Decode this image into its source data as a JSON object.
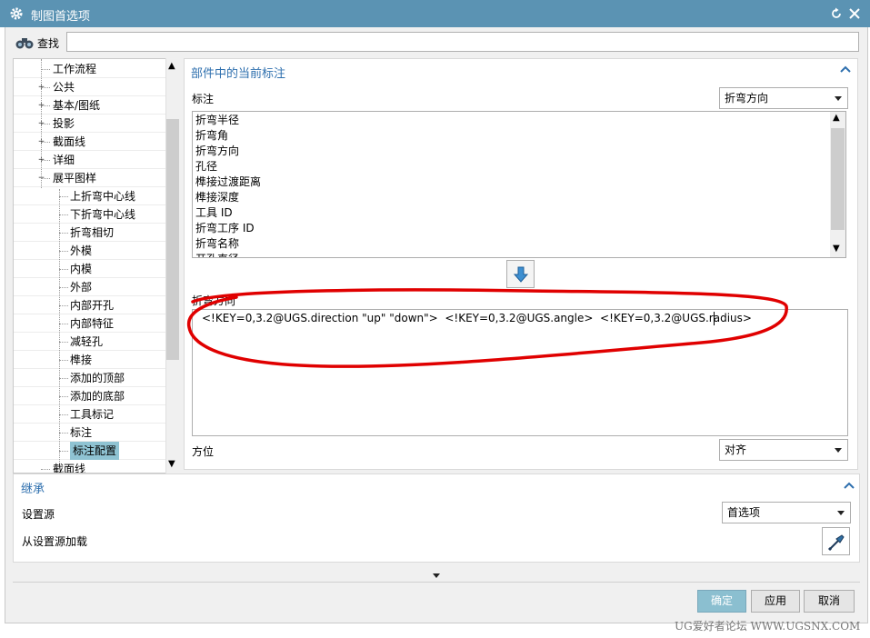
{
  "window": {
    "title": "制图首选项",
    "title_icon": "gear-icon",
    "reset_icon": "reset-icon",
    "close_icon": "close-icon"
  },
  "search": {
    "label": "查找",
    "value": "",
    "icon": "binoculars-icon"
  },
  "tree": {
    "items": [
      {
        "label": "工作流程",
        "level": 1,
        "expander": ""
      },
      {
        "label": "公共",
        "level": 1,
        "expander": "+"
      },
      {
        "label": "基本/图纸",
        "level": 1,
        "expander": "+"
      },
      {
        "label": "投影",
        "level": 1,
        "expander": "+"
      },
      {
        "label": "截面线",
        "level": 1,
        "expander": "+"
      },
      {
        "label": "详细",
        "level": 1,
        "expander": "+"
      },
      {
        "label": "展平图样",
        "level": 1,
        "expander": "−"
      },
      {
        "label": "上折弯中心线",
        "level": 2,
        "expander": ""
      },
      {
        "label": "下折弯中心线",
        "level": 2,
        "expander": ""
      },
      {
        "label": "折弯相切",
        "level": 2,
        "expander": ""
      },
      {
        "label": "外模",
        "level": 2,
        "expander": ""
      },
      {
        "label": "内模",
        "level": 2,
        "expander": ""
      },
      {
        "label": "外部",
        "level": 2,
        "expander": ""
      },
      {
        "label": "内部开孔",
        "level": 2,
        "expander": ""
      },
      {
        "label": "内部特征",
        "level": 2,
        "expander": ""
      },
      {
        "label": "减轻孔",
        "level": 2,
        "expander": ""
      },
      {
        "label": "榫接",
        "level": 2,
        "expander": ""
      },
      {
        "label": "添加的顶部",
        "level": 2,
        "expander": ""
      },
      {
        "label": "添加的底部",
        "level": 2,
        "expander": ""
      },
      {
        "label": "工具标记",
        "level": 2,
        "expander": ""
      },
      {
        "label": "标注",
        "level": 2,
        "expander": ""
      },
      {
        "label": "标注配置",
        "level": 2,
        "expander": "",
        "selected": true
      },
      {
        "label": "截面线",
        "level": 1,
        "expander": ""
      }
    ]
  },
  "section": {
    "title": "部件中的当前标注",
    "callout_label": "标注",
    "callout_value": "折弯方向",
    "list_items": [
      "折弯半径",
      "折弯角",
      "折弯方向",
      "孔径",
      "榫接过渡距离",
      "榫接深度",
      "工具 ID",
      "折弯工序 ID",
      "折弯名称",
      "开孔直径"
    ],
    "insert_icon": "arrow-down-icon",
    "text_label": "折弯方向",
    "text_value": "<!KEY=0,3.2@UGS.direction \"up\" \"down\">  <!KEY=0,3.2@UGS.angle>  <!KEY=0,3.2@UGS.radius>",
    "orientation_label": "方位",
    "orientation_value": "对齐"
  },
  "inherit": {
    "title": "继承",
    "source_label": "设置源",
    "source_value": "首选项",
    "load_label": "从设置源加载",
    "load_icon": "eyedropper-icon"
  },
  "buttons": {
    "ok": "确定",
    "apply": "应用",
    "cancel": "取消"
  },
  "watermark": "UG爱好者论坛 WWW.UGSNX.COM",
  "colors": {
    "titlebar": "#5b93b3",
    "accent": "#2e6fae",
    "selected": "#8fc3d3",
    "ok_button": "#8bbfd0",
    "annotation": "#e00000"
  }
}
